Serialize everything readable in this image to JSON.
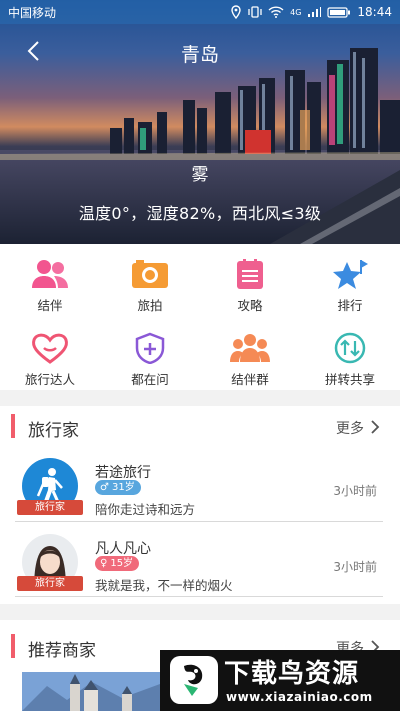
{
  "status_bar": {
    "carrier": "中国移动",
    "network": "4G",
    "time": "18:44"
  },
  "header": {
    "title": "青岛",
    "weather": "雾",
    "weather_detail": "温度0°，湿度82%，西北风≤3级"
  },
  "grid_menu": [
    {
      "label": "结伴",
      "icon": "two-people-icon",
      "color": "#f2558f"
    },
    {
      "label": "旅拍",
      "icon": "camera-icon",
      "color": "#f59b34"
    },
    {
      "label": "攻略",
      "icon": "notepad-icon",
      "color": "#ef5f8f"
    },
    {
      "label": "排行",
      "icon": "star-flag-icon",
      "color": "#3b8be0"
    },
    {
      "label": "旅行达人",
      "icon": "heart-icon",
      "color": "#ef5573"
    },
    {
      "label": "都在问",
      "icon": "shield-plus-icon",
      "color": "#8a58d6"
    },
    {
      "label": "结伴群",
      "icon": "group-icon",
      "color": "#f58a55"
    },
    {
      "label": "拼转共享",
      "icon": "swap-arrows-icon",
      "color": "#39b8b2"
    }
  ],
  "travelers": {
    "title": "旅行家",
    "more": "更多",
    "items": [
      {
        "name": "若途旅行",
        "gender": "male",
        "gender_symbol": "♂",
        "age": "31岁",
        "age_color": "#58a6de",
        "signature": "陪你走过诗和远方",
        "time": "3小时前",
        "tag": "旅行家"
      },
      {
        "name": "凡人凡心",
        "gender": "female",
        "gender_symbol": "♀",
        "age": "15岁",
        "age_color": "#f06a7a",
        "signature": "我就是我，不一样的烟火",
        "time": "3小时前",
        "tag": "旅行家"
      }
    ]
  },
  "merchants": {
    "title": "推荐商家",
    "more": "更多"
  },
  "watermark": {
    "title": "下载鸟资源",
    "url": "www.xiazainiao.com"
  }
}
